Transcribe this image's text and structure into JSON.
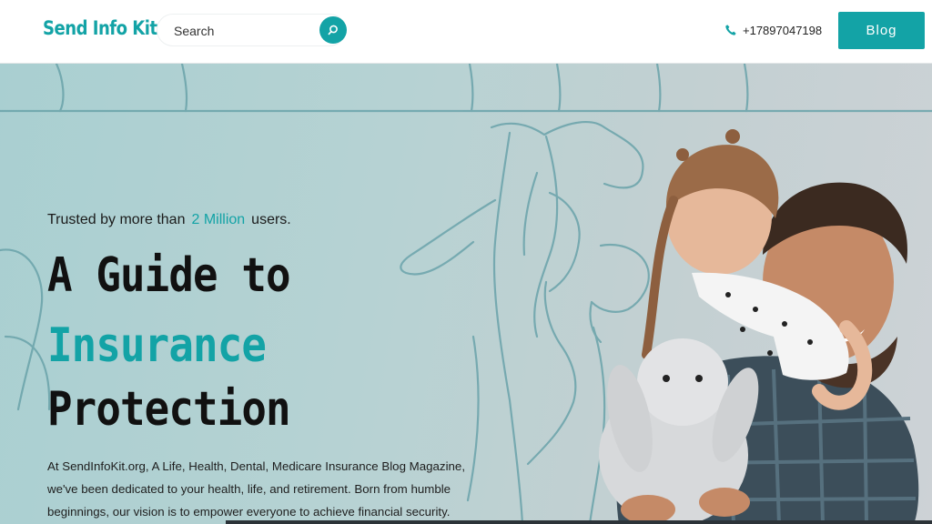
{
  "header": {
    "logo": "Send Info Kit",
    "search": {
      "placeholder": "Search",
      "value": ""
    },
    "phone": "+17897047198",
    "blog_label": "Blog"
  },
  "hero": {
    "trusted_prefix": "Trusted by more than",
    "trusted_highlight": "2 Million",
    "trusted_suffix": "users.",
    "headline_line1": "A Guide to",
    "headline_line2": "Insurance",
    "headline_line3": "Protection",
    "description": "At SendInfoKit.org, A Life, Health, Dental, Medicare Insurance Blog Magazine, we've been dedicated to your health, life, and retirement. Born from humble beginnings, our vision is to empower everyone to achieve financial security."
  },
  "colors": {
    "accent": "#13a3a6",
    "text": "#111111"
  },
  "icons": {
    "search": "search-icon",
    "phone": "phone-icon"
  }
}
